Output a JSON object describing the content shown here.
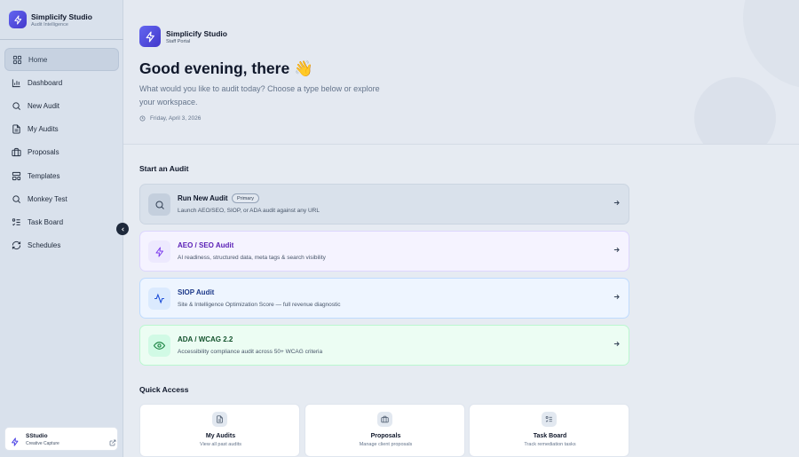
{
  "sidebar": {
    "brand": {
      "title": "Simplicify Studio",
      "subtitle": "Audit Intelligence"
    },
    "items": [
      {
        "label": "Home",
        "icon": "grid-icon",
        "active": true
      },
      {
        "label": "Dashboard",
        "icon": "bar-chart-icon"
      },
      {
        "label": "New Audit",
        "icon": "search-icon"
      },
      {
        "label": "My Audits",
        "icon": "document-icon"
      },
      {
        "label": "Proposals",
        "icon": "briefcase-icon"
      },
      {
        "label": "Templates",
        "icon": "template-icon"
      },
      {
        "label": "Monkey Test",
        "icon": "search-icon"
      },
      {
        "label": "Task Board",
        "icon": "checklist-icon"
      },
      {
        "label": "Schedules",
        "icon": "refresh-icon"
      }
    ],
    "footer": {
      "title": "SStudio",
      "subtitle": "Creative Capture"
    }
  },
  "hero": {
    "title": "Simplicify Studio",
    "subtitle": "Staff Portal",
    "greeting": "Good evening, there 👋",
    "description": "What would you like to audit today? Choose a type below or explore your workspace.",
    "date": "Friday, April 3, 2026"
  },
  "start_audit": {
    "heading": "Start an Audit",
    "cards": [
      {
        "title": "Run New Audit",
        "badge": "Primary",
        "description": "Launch AEO/SEO, SIOP, or ADA audit against any URL",
        "icon": "search-icon",
        "accent": "#0f172a"
      },
      {
        "title": "AEO / SEO Audit",
        "description": "AI readiness, structured data, meta tags & search visibility",
        "icon": "lightning-icon",
        "accent": "#5b21b6"
      },
      {
        "title": "SIOP Audit",
        "description": "Site & Intelligence Optimization Score — full revenue diagnostic",
        "icon": "activity-icon",
        "accent": "#1e3a8a"
      },
      {
        "title": "ADA / WCAG 2.2",
        "description": "Accessibility compliance audit across 50+ WCAG criteria",
        "icon": "eye-icon",
        "accent": "#14532d"
      }
    ]
  },
  "quick_access": {
    "heading": "Quick Access",
    "items": [
      {
        "title": "My Audits",
        "description": "View all past audits",
        "icon": "document-icon"
      },
      {
        "title": "Proposals",
        "description": "Manage client proposals",
        "icon": "briefcase-icon"
      },
      {
        "title": "Task Board",
        "description": "Track remediation tasks",
        "icon": "checklist-icon"
      }
    ]
  }
}
